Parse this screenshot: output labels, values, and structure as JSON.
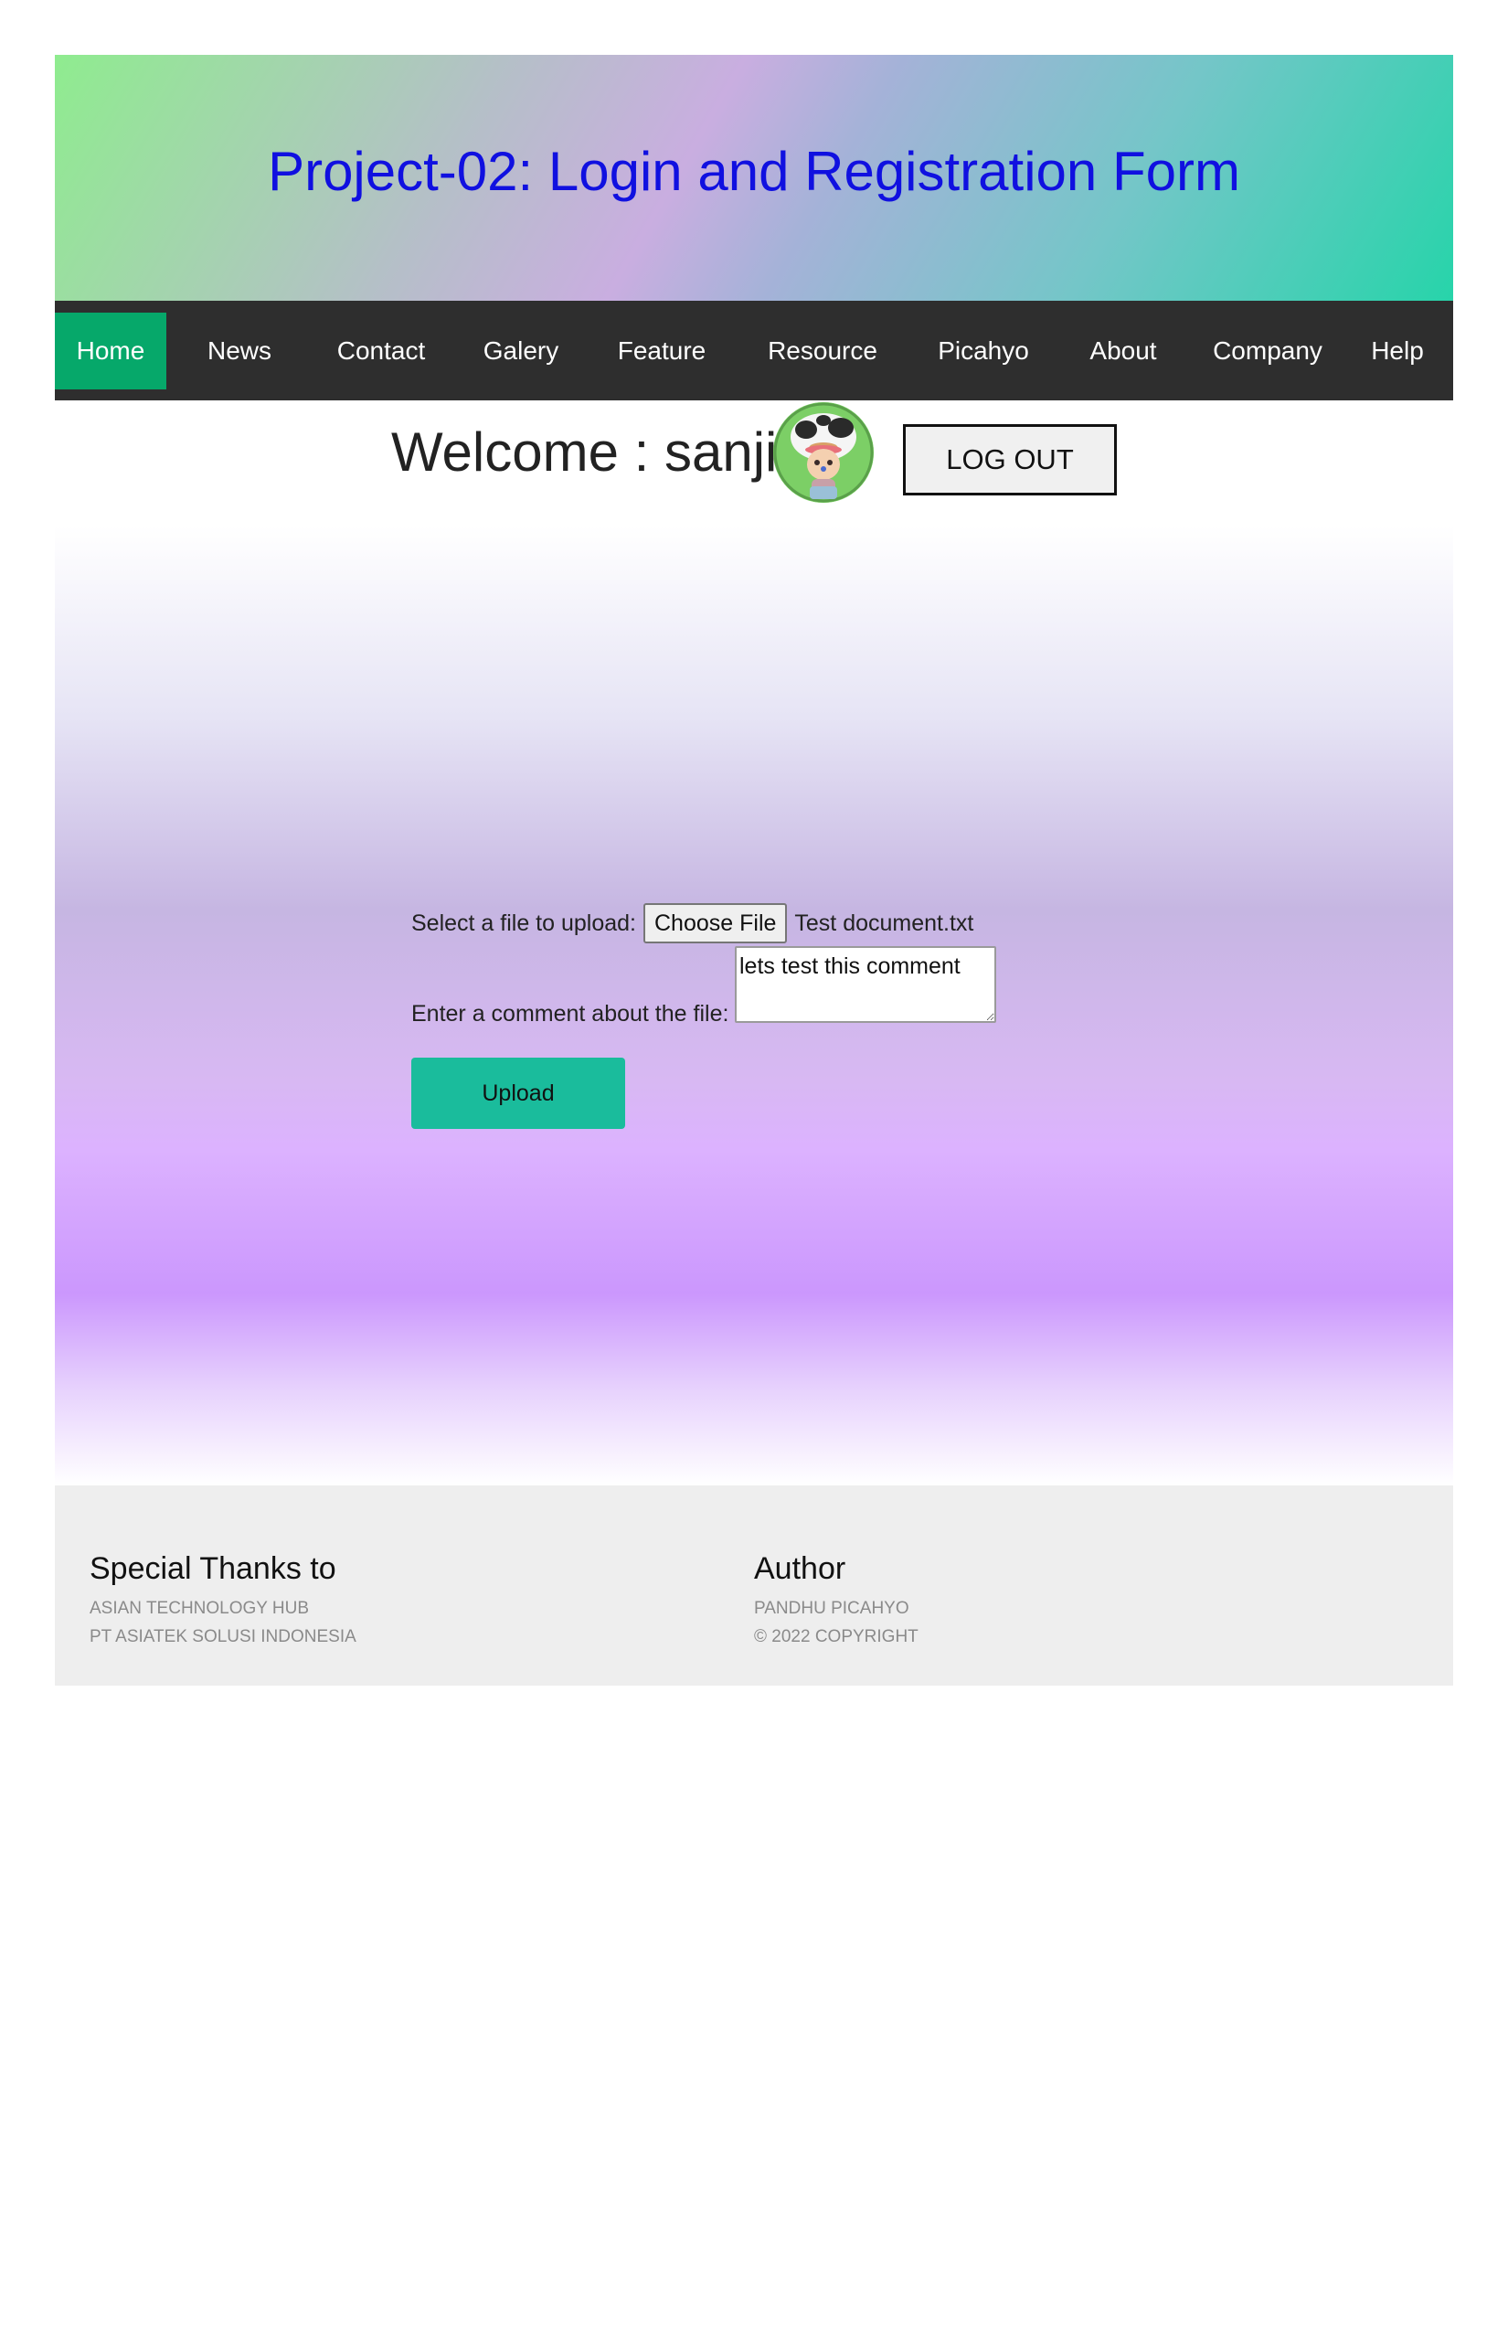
{
  "header": {
    "title": "Project-02: Login and Registration Form",
    "title_color": "#1010e0"
  },
  "nav": {
    "active_color": "#06a86a",
    "items": [
      {
        "label": "Home",
        "active": true
      },
      {
        "label": "News"
      },
      {
        "label": "Contact"
      },
      {
        "label": "Galery"
      },
      {
        "label": "Feature"
      },
      {
        "label": "Resource"
      },
      {
        "label": "Picahyo"
      },
      {
        "label": "About"
      },
      {
        "label": "Company"
      },
      {
        "label": "Help"
      }
    ]
  },
  "welcome": {
    "text": "Welcome : sanji",
    "avatar_icon": "cartoon-character-avatar",
    "logout_label": "LOG OUT"
  },
  "upload_form": {
    "file_label": "Select a file to upload:",
    "choose_button_label": "Choose File",
    "selected_file": "Test document.txt",
    "comment_label": "Enter a comment about the file:",
    "comment_value": "lets test this comment",
    "upload_button_label": "Upload",
    "upload_button_color": "#1abc9c"
  },
  "footer": {
    "thanks": {
      "heading": "Special Thanks to",
      "lines": [
        "ASIAN TECHNOLOGY HUB",
        "PT ASIATEK SOLUSI INDONESIA"
      ]
    },
    "author": {
      "heading": "Author",
      "lines": [
        "PANDHU PICAHYO",
        "© 2022 COPYRIGHT"
      ]
    }
  }
}
